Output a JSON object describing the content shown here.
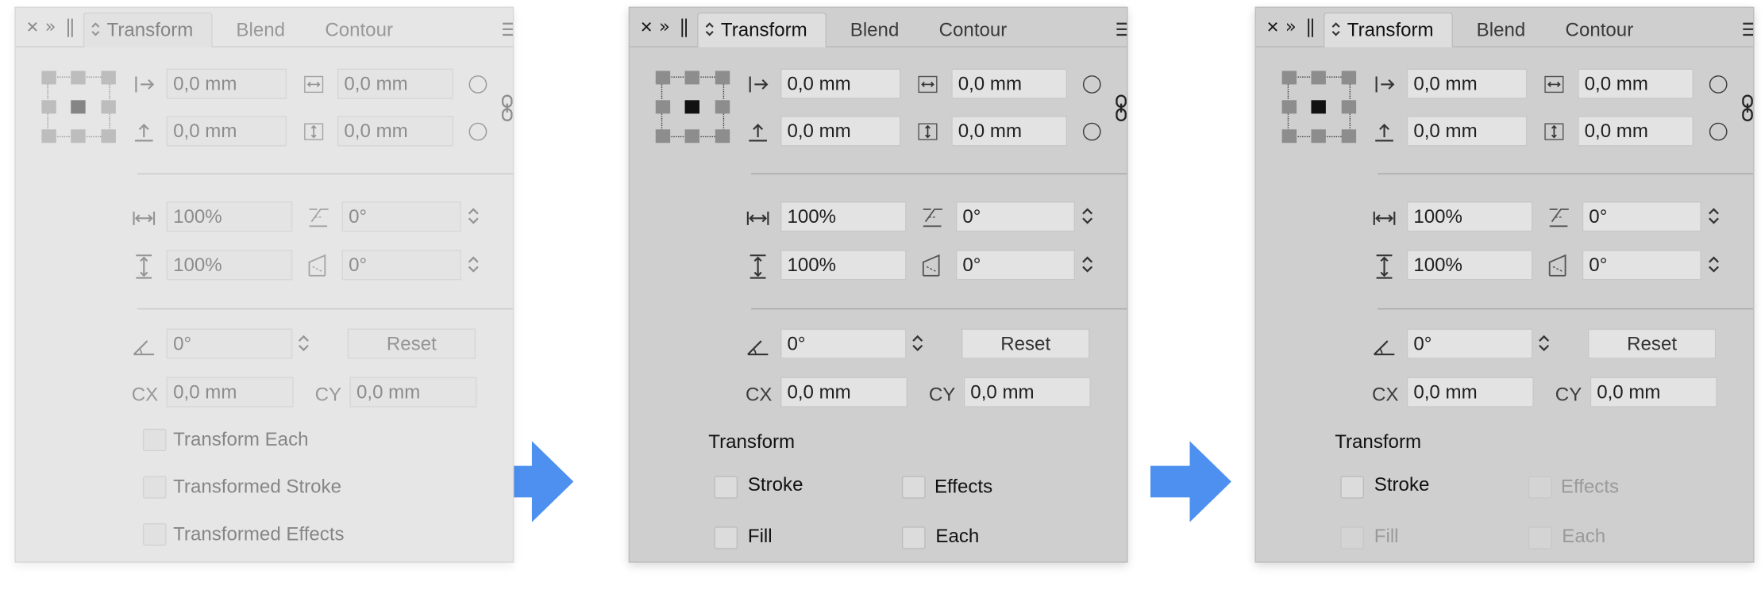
{
  "colors": {
    "arrow": "#4d90f0",
    "panel_bg": "#cfcfcf",
    "panel_disabled_bg": "#e6e6e6"
  },
  "header": {
    "close_icon": "close-icon",
    "collapse_icon": "double-chevron-right-icon",
    "grip_icon": "grip-icon",
    "tab_icon": "up-down-chevron-icon",
    "tabs": [
      "Transform",
      "Blend",
      "Contour"
    ],
    "menu_icon": "hamburger-menu-icon"
  },
  "fields": {
    "x": "0,0 mm",
    "y": "0,0 mm",
    "width": "0,0 mm",
    "height": "0,0 mm",
    "scale_x": "100%",
    "scale_y": "100%",
    "shear_x": "0°",
    "shear_y": "0°",
    "rotate": "0°",
    "cx": "0,0 mm",
    "cy": "0,0 mm"
  },
  "labels": {
    "cx": "CX",
    "cy": "CY",
    "reset": "Reset"
  },
  "panels": [
    {
      "state": "disabled",
      "options_layout": "list",
      "options": [
        {
          "label": "Transform Each",
          "enabled": true
        },
        {
          "label": "Transformed Stroke",
          "enabled": true
        },
        {
          "label": "Transformed Effects",
          "enabled": true
        }
      ]
    },
    {
      "state": "enabled",
      "options_layout": "grid",
      "section_title": "Transform",
      "options": [
        {
          "label": "Stroke",
          "enabled": true
        },
        {
          "label": "Effects",
          "enabled": true
        },
        {
          "label": "Fill",
          "enabled": true
        },
        {
          "label": "Each",
          "enabled": true
        }
      ]
    },
    {
      "state": "enabled",
      "options_layout": "grid",
      "section_title": "Transform",
      "options": [
        {
          "label": "Stroke",
          "enabled": true
        },
        {
          "label": "Effects",
          "enabled": false
        },
        {
          "label": "Fill",
          "enabled": false
        },
        {
          "label": "Each",
          "enabled": false
        }
      ]
    }
  ]
}
